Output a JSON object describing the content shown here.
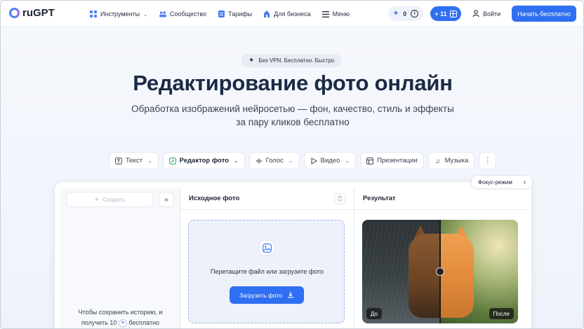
{
  "header": {
    "logo": "ruGPT",
    "nav": [
      {
        "label": "Инструменты",
        "icon": "grid-icon",
        "has_dropdown": true
      },
      {
        "label": "Сообщество",
        "icon": "community-icon",
        "has_dropdown": false
      },
      {
        "label": "Тарифы",
        "icon": "tariff-icon",
        "has_dropdown": false
      },
      {
        "label": "Для бизнеса",
        "icon": "business-icon",
        "has_dropdown": false
      },
      {
        "label": "Меню",
        "icon": "menu-icon",
        "has_dropdown": false
      }
    ],
    "credits": "0",
    "bonus": "+ 11",
    "login": "Войти",
    "start": "Начать бесплатно"
  },
  "hero": {
    "badge": "Без VPN. Бесплатно. Быстро",
    "title": "Редактирование фото онлайн",
    "subtitle_line1": "Обработка изображений нейросетью — фон, качество, стиль и эффекты",
    "subtitle_line2": "за пару кликов бесплатно"
  },
  "tabs": [
    {
      "label": "Текст",
      "icon": "text-icon",
      "has_dropdown": true,
      "active": false
    },
    {
      "label": "Редактор фото",
      "icon": "photo-edit-icon",
      "has_dropdown": true,
      "active": true
    },
    {
      "label": "Голос",
      "icon": "voice-icon",
      "has_dropdown": true,
      "active": false
    },
    {
      "label": "Видео",
      "icon": "video-icon",
      "has_dropdown": true,
      "active": false
    },
    {
      "label": "Презентации",
      "icon": "presentation-icon",
      "has_dropdown": false,
      "active": false
    },
    {
      "label": "Музыка",
      "icon": "music-icon",
      "has_dropdown": false,
      "active": false
    }
  ],
  "focus_mode": "Фокус-режим",
  "workspace": {
    "create": "Создать",
    "history_line1": "Чтобы сохранить историю, и",
    "history_line2_pre": "получить 10",
    "history_line2_post": "бесплатно",
    "source_title": "Исходное фото",
    "drop_text": "Перетащите файл или загрузите фото",
    "upload": "Загрузить фото",
    "result_title": "Результат",
    "before": "До",
    "after": "После"
  },
  "colors": {
    "accent": "#2f6ff2",
    "background": "#eef3fb",
    "title": "#1b2a44"
  }
}
